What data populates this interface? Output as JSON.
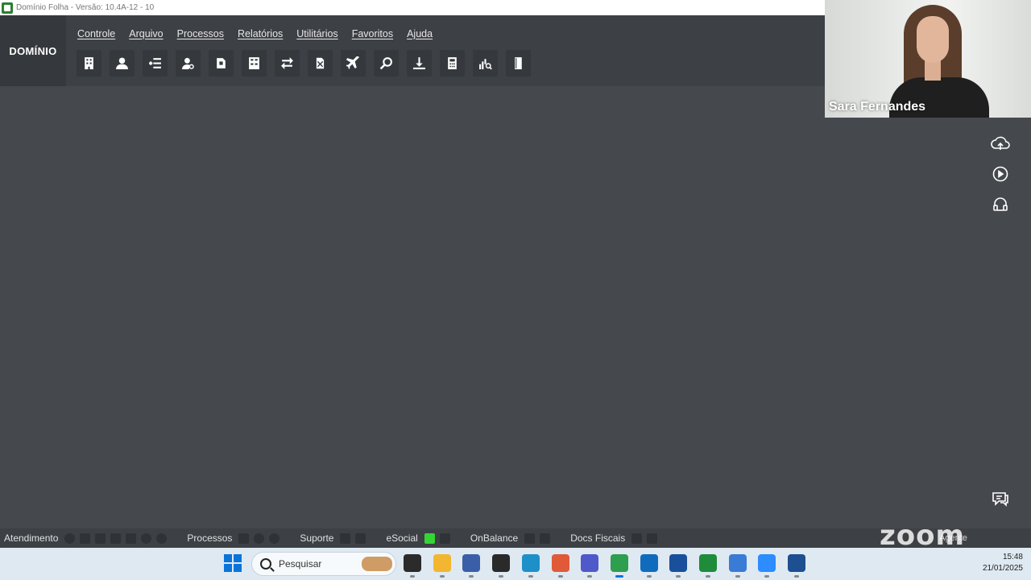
{
  "window": {
    "title": "Domínio Folha - Versão: 10.4A-12 - 10"
  },
  "brand": "DOMÍNIO",
  "menu": [
    {
      "label": "Controle"
    },
    {
      "label": "Arquivo"
    },
    {
      "label": "Processos"
    },
    {
      "label": "Relatórios"
    },
    {
      "label": "Utilitários"
    },
    {
      "label": "Favoritos"
    },
    {
      "label": "Ajuda"
    }
  ],
  "toolbar": [
    {
      "icon": "building-icon"
    },
    {
      "icon": "employee-icon"
    },
    {
      "icon": "list-add-icon"
    },
    {
      "icon": "user-search-icon"
    },
    {
      "icon": "document-edit-icon"
    },
    {
      "icon": "calculator-sheet-icon"
    },
    {
      "icon": "swap-icon"
    },
    {
      "icon": "document-x-icon"
    },
    {
      "icon": "airplane-icon"
    },
    {
      "icon": "search-icon"
    },
    {
      "icon": "download-icon"
    },
    {
      "icon": "calculator-icon"
    },
    {
      "icon": "chart-search-icon"
    },
    {
      "icon": "book-icon"
    }
  ],
  "video": {
    "participant_name": "Sara Fernandes"
  },
  "side_icons": [
    {
      "icon": "cloud-upload-icon"
    },
    {
      "icon": "play-circle-icon"
    },
    {
      "icon": "headset-icon"
    },
    {
      "icon": "chat-icon"
    }
  ],
  "statusbar": {
    "atendimento": "Atendimento",
    "processos": "Processos",
    "suporte": "Suporte",
    "esocial": "eSocial",
    "onbalance": "OnBalance",
    "docs_fiscais": "Docs Fiscais",
    "agente": "Agente",
    "zoom_logo": "zoom"
  },
  "taskbar": {
    "search_placeholder": "Pesquisar",
    "time": "15:48",
    "date": "21/01/2025",
    "apps": [
      {
        "icon": "task-view-icon",
        "color": "#2b2b2b"
      },
      {
        "icon": "file-explorer-icon",
        "color": "#f2b630"
      },
      {
        "icon": "notes-app-icon",
        "color": "#3a5fa8"
      },
      {
        "icon": "sticky-notes-icon",
        "color": "#2a2a2a"
      },
      {
        "icon": "cloud-app-icon",
        "color": "#1e90c8"
      },
      {
        "icon": "office-icon",
        "color": "#e05a3a"
      },
      {
        "icon": "teams-icon",
        "color": "#5059c9"
      },
      {
        "icon": "chrome-icon",
        "color": "#2e9e4f"
      },
      {
        "icon": "outlook-icon",
        "color": "#0f6cbd"
      },
      {
        "icon": "upload-app-icon",
        "color": "#1a4f9c"
      },
      {
        "icon": "download-app-icon",
        "color": "#1e8c3a"
      },
      {
        "icon": "notepad-icon",
        "color": "#3a7bd5"
      },
      {
        "icon": "zoom-app-icon",
        "color": "#2d8cff"
      },
      {
        "icon": "mail-app-icon",
        "color": "#1d4f91"
      }
    ]
  }
}
